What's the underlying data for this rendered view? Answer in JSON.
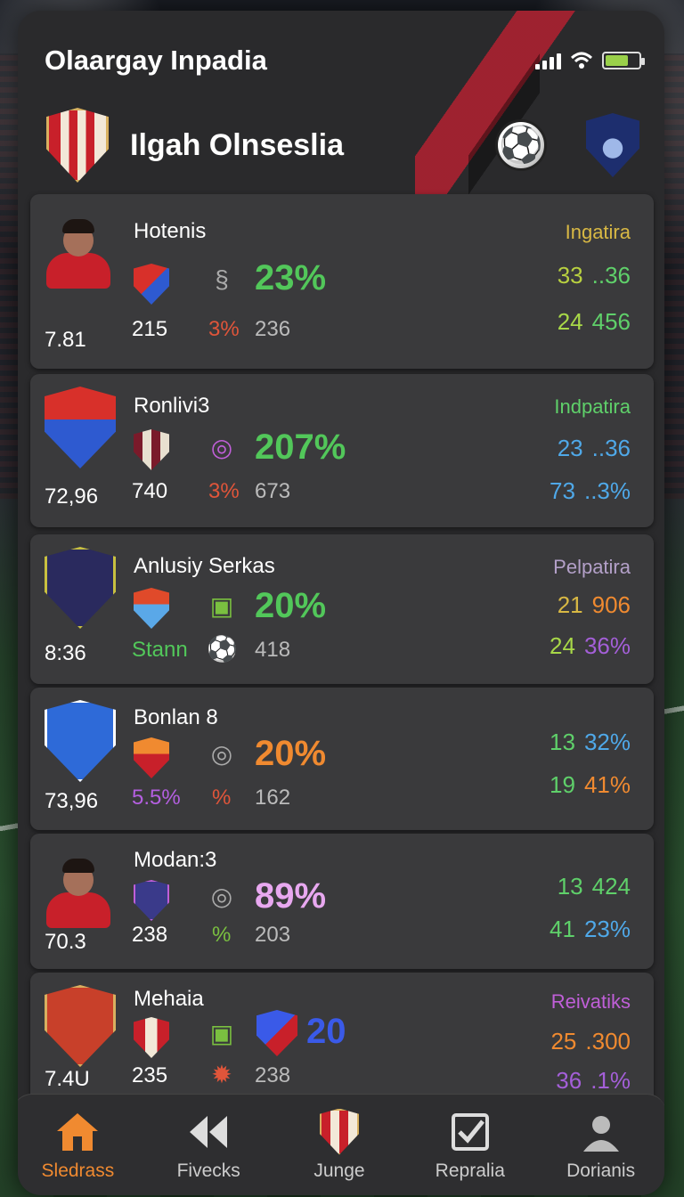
{
  "app_title": "Olaargay Inpadia",
  "match": {
    "title": "Ilgah Olnseslia"
  },
  "colors": {
    "accent": "#f08a30",
    "green": "#52c75a",
    "card": "#3a3a3c"
  },
  "players": [
    {
      "name": "Hotenis",
      "rating": "7.81",
      "pct": "23%",
      "pct_color": "#52c75a",
      "val1": "215",
      "val2": "3%",
      "val2_color": "#e0553a",
      "val3": "236",
      "right_label": "Ingatira",
      "right_label_color": "#d8b844",
      "r1a": "33",
      "r1a_color": "#b8d040",
      "r1b": "..36",
      "r1b_color": "#5fd06a",
      "r2a": "24",
      "r2a_color": "#a8d848",
      "r2b": "456",
      "r2b_color": "#5fd06a"
    },
    {
      "name": "Ronlivi3",
      "rating": "72,96",
      "pct": "207%",
      "pct_color": "#52c75a",
      "val1": "740",
      "val2": "3%",
      "val2_color": "#e0553a",
      "val3": "673",
      "right_label": "Indpatira",
      "right_label_color": "#5fd06a",
      "r1a": "23",
      "r1a_color": "#4fa8e8",
      "r1b": "..36",
      "r1b_color": "#4fa8e8",
      "r2a": "73",
      "r2a_color": "#4fa8e8",
      "r2b": "..3%",
      "r2b_color": "#4fa8e8"
    },
    {
      "name": "Anlusiy Serkas",
      "rating": "8:36",
      "pct": "20%",
      "pct_color": "#52c75a",
      "val1": "Stann",
      "val1_color": "#52c75a",
      "val2": "",
      "val3": "418",
      "right_label": "Pelpatira",
      "right_label_color": "#b3a0c8",
      "r1a": "21",
      "r1a_color": "#d8b844",
      "r1b": "906",
      "r1b_color": "#f08a30",
      "r2a": "24",
      "r2a_color": "#a8d848",
      "r2b": "36%",
      "r2b_color": "#a45fd8"
    },
    {
      "name": "Bonlan 8",
      "rating": "73,96",
      "pct": "20%",
      "pct_color": "#f08a30",
      "val1": "5.5%",
      "val1_color": "#b45fe0",
      "val2": "%",
      "val2_color": "#e0553a",
      "val3": "162",
      "right_label": "",
      "right_label_color": "#fff",
      "r1a": "13",
      "r1a_color": "#5fd06a",
      "r1b": "32%",
      "r1b_color": "#4fa8e8",
      "r2a": "19",
      "r2a_color": "#5fd06a",
      "r2b": "41%",
      "r2b_color": "#f08a30"
    },
    {
      "name": "Modan:3",
      "rating": "70.3",
      "pct": "89%",
      "pct_color": "#e8a8f0",
      "val1": "238",
      "val2": "%",
      "val2_color": "#7ac040",
      "val3": "203",
      "right_label": "",
      "right_label_color": "#fff",
      "r1a": "13",
      "r1a_color": "#5fd06a",
      "r1b": "424",
      "r1b_color": "#5fd06a",
      "r2a": "41",
      "r2a_color": "#5fd06a",
      "r2b": "23%",
      "r2b_color": "#4fa8e8"
    },
    {
      "name": "Mehaia",
      "rating": "7.4U",
      "pct": "20",
      "pct_color": "#3a5ae8",
      "val1": "235",
      "val2": "",
      "val3": "238",
      "right_label": "Reivatiks",
      "right_label_color": "#c05fd8",
      "r1a": "25",
      "r1a_color": "#f08a30",
      "r1b": ".300",
      "r1b_color": "#f08a30",
      "r2a": "36",
      "r2a_color": "#a45fd8",
      "r2b": ".1%",
      "r2b_color": "#a45fd8"
    }
  ],
  "nav": [
    {
      "label": "Sledrass",
      "icon": "home-icon",
      "active": true
    },
    {
      "label": "Fivecks",
      "icon": "rewind-icon"
    },
    {
      "label": "Junge",
      "icon": "club-crest-icon"
    },
    {
      "label": "Repralia",
      "icon": "checkbox-icon"
    },
    {
      "label": "Dorianis",
      "icon": "user-icon"
    }
  ]
}
